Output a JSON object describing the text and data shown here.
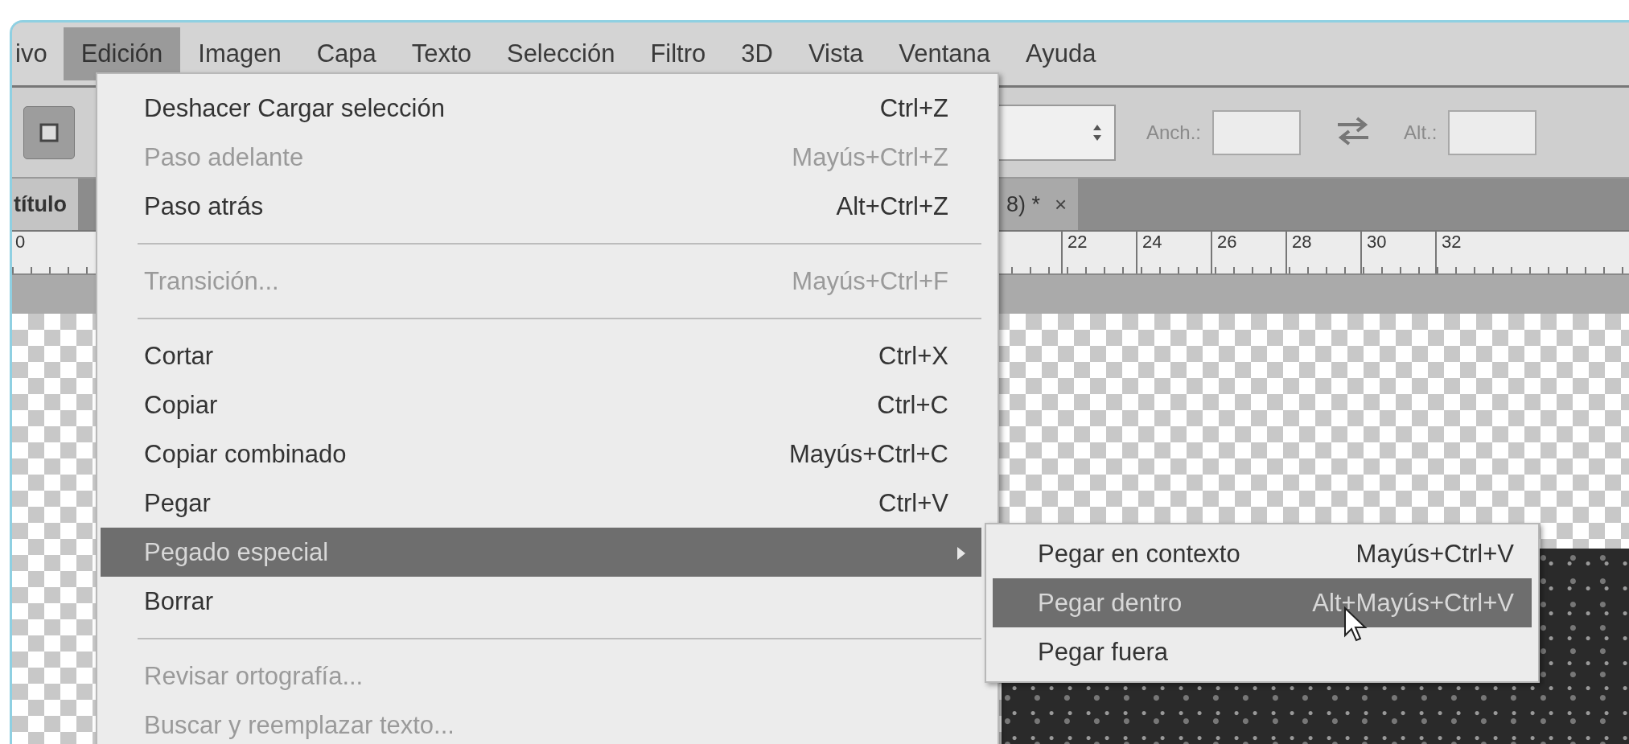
{
  "menubar": [
    {
      "label": "ivo",
      "selected": false
    },
    {
      "label": "Edición",
      "selected": true
    },
    {
      "label": "Imagen",
      "selected": false
    },
    {
      "label": "Capa",
      "selected": false
    },
    {
      "label": "Texto",
      "selected": false
    },
    {
      "label": "Selección",
      "selected": false
    },
    {
      "label": "Filtro",
      "selected": false
    },
    {
      "label": "3D",
      "selected": false
    },
    {
      "label": "Vista",
      "selected": false
    },
    {
      "label": "Ventana",
      "selected": false
    },
    {
      "label": "Ayuda",
      "selected": false
    }
  ],
  "options_bar": {
    "width_label": "Anch.:",
    "height_label": "Alt.:"
  },
  "tabs": [
    {
      "label": "título",
      "selected": false
    },
    {
      "label": "8) *",
      "close": "×",
      "selected": true
    }
  ],
  "ruler": {
    "labels": [
      "0",
      "22",
      "24",
      "26",
      "28",
      "30",
      "32"
    ]
  },
  "edit_menu": {
    "items": [
      {
        "kind": "item",
        "label": "Deshacer Cargar selección",
        "shortcut": "Ctrl+Z",
        "disabled": false,
        "selected": false
      },
      {
        "kind": "item",
        "label": "Paso adelante",
        "shortcut": "Mayús+Ctrl+Z",
        "disabled": true,
        "selected": false
      },
      {
        "kind": "item",
        "label": "Paso atrás",
        "shortcut": "Alt+Ctrl+Z",
        "disabled": false,
        "selected": false
      },
      {
        "kind": "separator"
      },
      {
        "kind": "item",
        "label": "Transición...",
        "shortcut": "Mayús+Ctrl+F",
        "disabled": true,
        "selected": false
      },
      {
        "kind": "separator"
      },
      {
        "kind": "item",
        "label": "Cortar",
        "shortcut": "Ctrl+X",
        "disabled": false,
        "selected": false
      },
      {
        "kind": "item",
        "label": "Copiar",
        "shortcut": "Ctrl+C",
        "disabled": false,
        "selected": false
      },
      {
        "kind": "item",
        "label": "Copiar combinado",
        "shortcut": "Mayús+Ctrl+C",
        "disabled": false,
        "selected": false
      },
      {
        "kind": "item",
        "label": "Pegar",
        "shortcut": "Ctrl+V",
        "disabled": false,
        "selected": false
      },
      {
        "kind": "submenu",
        "label": "Pegado especial",
        "disabled": false,
        "selected": true
      },
      {
        "kind": "item",
        "label": "Borrar",
        "disabled": false,
        "selected": false
      },
      {
        "kind": "separator"
      },
      {
        "kind": "item",
        "label": "Revisar ortografía...",
        "disabled": true,
        "selected": false
      },
      {
        "kind": "item",
        "label": "Buscar y reemplazar texto...",
        "disabled": true,
        "selected": false
      }
    ]
  },
  "submenu": {
    "items": [
      {
        "label": "Pegar en contexto",
        "shortcut": "Mayús+Ctrl+V",
        "selected": false
      },
      {
        "label": "Pegar dentro",
        "shortcut": "Alt+Mayús+Ctrl+V",
        "selected": true
      },
      {
        "label": "Pegar fuera",
        "selected": false
      }
    ]
  }
}
